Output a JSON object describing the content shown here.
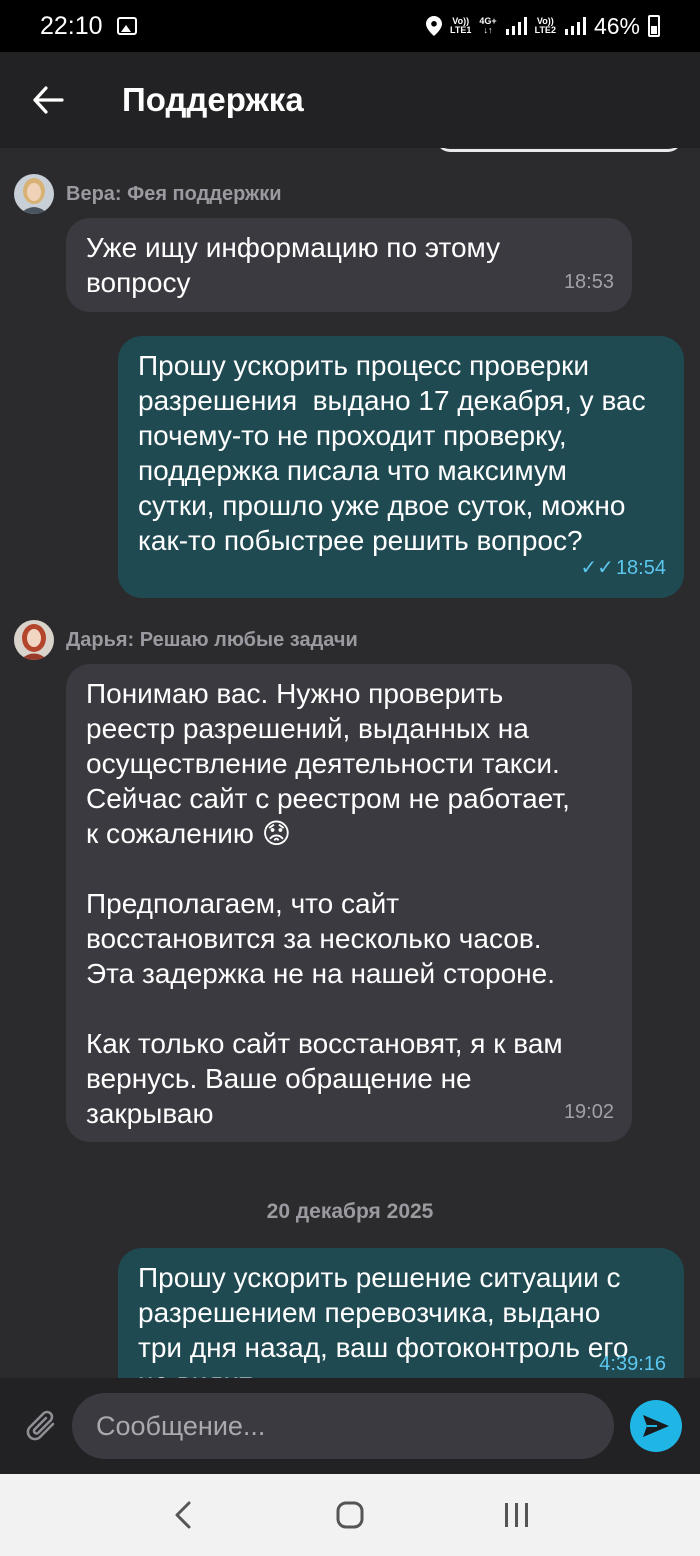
{
  "status_bar": {
    "time": "22:10",
    "net1_top": "Vo))",
    "net1_bottom": "LTE1",
    "net_4g_top": "4G+",
    "net_4g_bottom": "↓↑",
    "net2_top": "Vo))",
    "net2_bottom": "LTE2",
    "battery": "46%"
  },
  "header": {
    "title": "Поддержка"
  },
  "messages": [
    {
      "sender": "Вера: Фея поддержки",
      "text": "Уже ищу информацию по этому\nвопросу",
      "time": "18:53"
    },
    {
      "text": "Прошу ускорить процесс проверки\nразрешения  выдано 17 декабря, у вас\nпочему-то не проходит проверку,\nподдержка писала что максимум\nсутки, прошло уже двое суток, можно\nкак-то побыстрее решить вопрос?",
      "time": "18:54",
      "ticks": "✓✓"
    },
    {
      "sender": "Дарья: Решаю любые задачи",
      "text": "Понимаю вас. Нужно проверить\nреестр разрешений, выданных на\nосуществление деятельности такси.\nСейчас сайт с реестром не работает,\nк сожалению 😟\n\nПредполагаем, что сайт\nвосстановится за несколько часов.\nЭта задержка не на нашей стороне.\n\nКак только сайт восстановят, я к вам\nвернусь. Ваше обращение не\nзакрываю",
      "time": "19:02"
    },
    {
      "text": "Прошу ускорить решение ситуации с\nразрешением перевозчика, выдано\nтри дня назад, ваш фотоконтроль его\nне видит",
      "time": "4:39:16"
    }
  ],
  "date_separator": "20 декабря 2025",
  "composer": {
    "placeholder": "Сообщение..."
  },
  "colors": {
    "accent": "#1fb6e6",
    "incoming_bubble": "#3a3a40",
    "outgoing_bubble": "#1f4a52",
    "time_outgoing": "#5cc7ee"
  }
}
